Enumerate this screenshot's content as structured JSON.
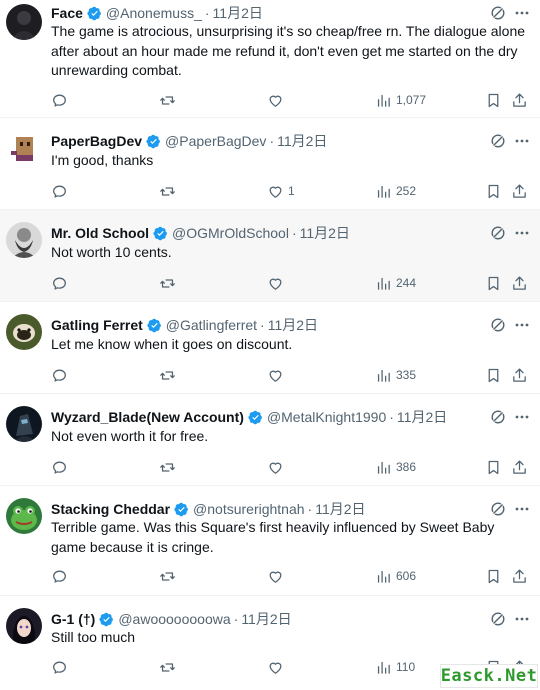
{
  "tweets": [
    {
      "name": "Face",
      "handle": "@Anonemuss_",
      "separator": "·",
      "date": "11月2日",
      "text": "The game is atrocious, unsurprising it's so cheap/free rn. The dialogue alone after about an hour made me refund it, don't even get me started on the dry unrewarding combat.",
      "reply_count": "",
      "retweet_count": "",
      "like_count": "",
      "views": "1,077",
      "verified": true,
      "avatar": "dark-silhouette-avatar"
    },
    {
      "name": "PaperBagDev",
      "handle": "@PaperBagDev",
      "separator": "·",
      "date": "11月2日",
      "text": "I'm good, thanks",
      "reply_count": "",
      "retweet_count": "",
      "like_count": "1",
      "views": "252",
      "verified": true,
      "avatar": "paper-bag-avatar"
    },
    {
      "name": "Mr. Old School",
      "handle": "@OGMrOldSchool",
      "separator": "·",
      "date": "11月2日",
      "text": "Not worth 10 cents.",
      "reply_count": "",
      "retweet_count": "",
      "like_count": "",
      "views": "244",
      "verified": true,
      "avatar": "bearded-man-avatar"
    },
    {
      "name": "Gatling Ferret",
      "handle": "@Gatlingferret",
      "separator": "·",
      "date": "11月2日",
      "text": "Let me know when it goes on discount.",
      "reply_count": "",
      "retweet_count": "",
      "like_count": "",
      "views": "335",
      "verified": true,
      "avatar": "ferret-avatar"
    },
    {
      "name": "Wyzard_Blade(New Account)",
      "handle": "@MetalKnight1990",
      "separator": "·",
      "date": "11月2日",
      "text": "Not even worth it for free.",
      "reply_count": "",
      "retweet_count": "",
      "like_count": "",
      "views": "386",
      "verified": true,
      "avatar": "armored-knight-avatar"
    },
    {
      "name": "Stacking Cheddar",
      "handle": "@notsurerightnah",
      "separator": "·",
      "date": "11月2日",
      "text": "Terrible game.  Was this Square's first heavily influenced by Sweet Baby game because it is cringe.",
      "reply_count": "",
      "retweet_count": "",
      "like_count": "",
      "views": "606",
      "verified": true,
      "avatar": "frog-avatar"
    },
    {
      "name": "G-1 (†)",
      "handle": "@awoooooooowa",
      "separator": "·",
      "date": "11月2日",
      "text": "Still too much",
      "reply_count": "",
      "retweet_count": "",
      "like_count": "",
      "views": "110",
      "verified": true,
      "avatar": "anime-girl-avatar"
    }
  ],
  "icons": {
    "verified": "verified-badge-icon",
    "grok": "grok-icon",
    "more": "more-options-icon",
    "reply": "reply-icon",
    "retweet": "retweet-icon",
    "like": "like-icon",
    "views": "views-icon",
    "bookmark": "bookmark-icon",
    "share": "share-icon"
  },
  "colors": {
    "verified_blue": "#1d9bf0",
    "text_primary": "#0f1419",
    "text_secondary": "#536471",
    "highlight_row": "#f7f7f7",
    "divider": "#eff3f4",
    "watermark_green": "#2e9a2e"
  },
  "watermark": "Easck.Net"
}
